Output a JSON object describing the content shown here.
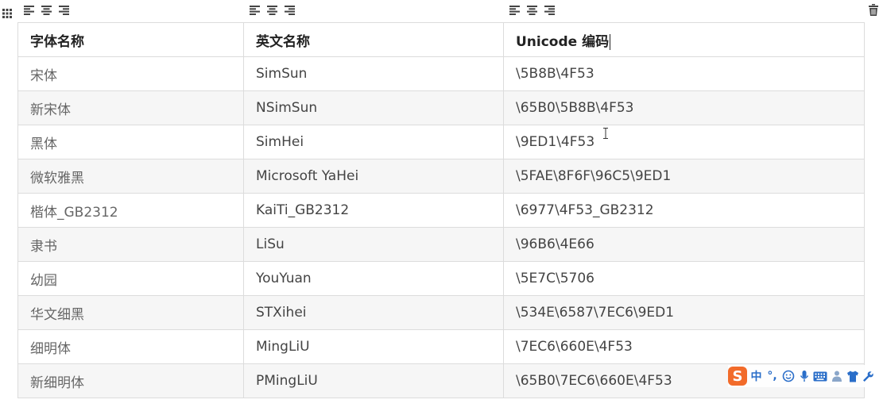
{
  "table": {
    "headers": [
      "字体名称",
      "英文名称",
      "Unicode 编码"
    ],
    "rows": [
      [
        "宋体",
        "SimSun",
        "\\5B8B\\4F53"
      ],
      [
        "新宋体",
        "NSimSun",
        "\\65B0\\5B8B\\4F53"
      ],
      [
        "黑体",
        "SimHei",
        "\\9ED1\\4F53"
      ],
      [
        "微软雅黑",
        "Microsoft YaHei",
        "\\5FAE\\8F6F\\96C5\\9ED1"
      ],
      [
        "楷体_GB2312",
        "KaiTi_GB2312",
        "\\6977\\4F53_GB2312"
      ],
      [
        "隶书",
        "LiSu",
        "\\96B6\\4E66"
      ],
      [
        "幼园",
        "YouYuan",
        "\\5E7C\\5706"
      ],
      [
        "华文细黑",
        "STXihei",
        "\\534E\\6587\\7EC6\\9ED1"
      ],
      [
        "细明体",
        "MingLiU",
        "\\7EC6\\660E\\4F53"
      ],
      [
        "新细明体",
        "PMingLiU",
        "\\65B0\\7EC6\\660E\\4F53"
      ]
    ]
  },
  "ime": {
    "logo": "S",
    "mode_label": "中",
    "punct_label": "°,",
    "icons": [
      "smiley-icon",
      "microphone-icon",
      "keyboard-icon",
      "person-icon",
      "shirt-icon",
      "wrench-icon"
    ]
  },
  "colors": {
    "ime_brand": "#f26b2a",
    "ime_icon": "#2a6ec9",
    "row_alt": "#f6f6f6",
    "border": "#dcdcdc"
  }
}
